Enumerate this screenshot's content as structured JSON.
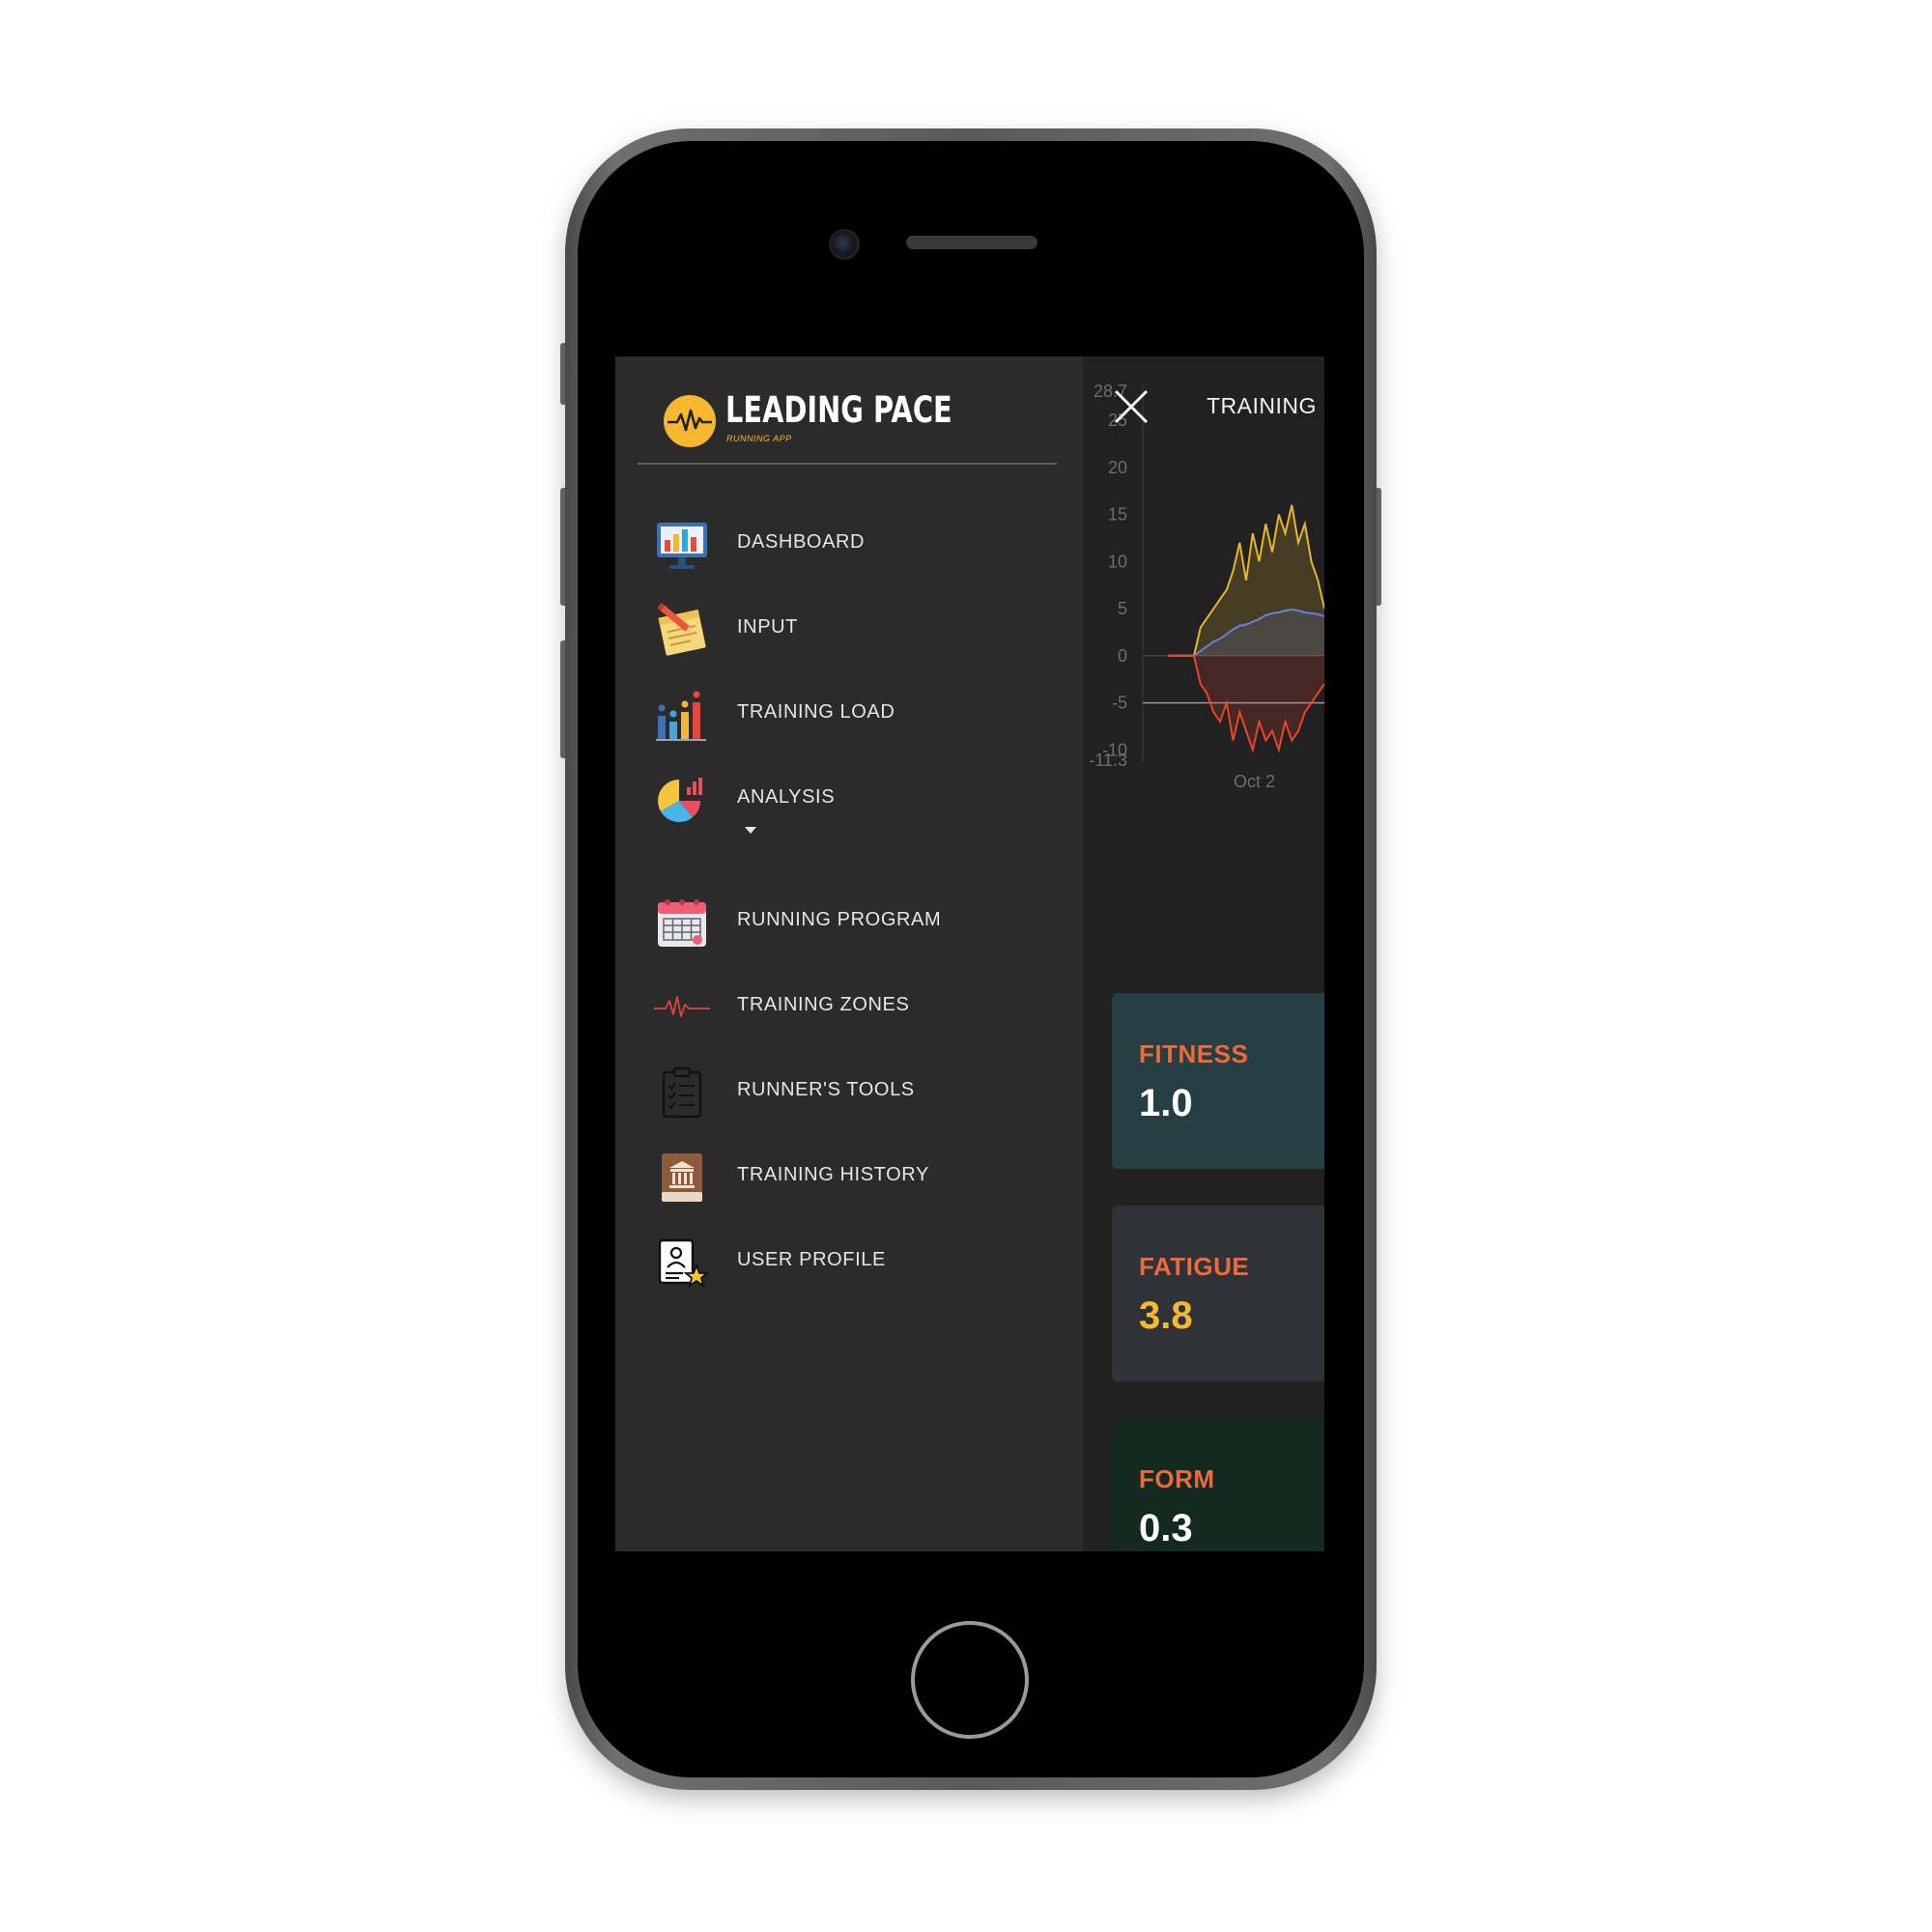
{
  "app": {
    "brand_name": "LEADING PACE",
    "brand_tagline": "RUNNING APP",
    "accent_color": "#f7b731"
  },
  "drawer": {
    "items": [
      {
        "label": "DASHBOARD",
        "icon": "dashboard-monitor-icon"
      },
      {
        "label": "INPUT",
        "icon": "notepad-pencil-icon"
      },
      {
        "label": "TRAINING LOAD",
        "icon": "bar-chart-icon"
      },
      {
        "label": "ANALYSIS",
        "icon": "pie-chart-icon",
        "expandable": true
      },
      {
        "label": "RUNNING PROGRAM",
        "icon": "calendar-icon"
      },
      {
        "label": "TRAINING ZONES",
        "icon": "heartbeat-icon"
      },
      {
        "label": "RUNNER'S TOOLS",
        "icon": "clipboard-checklist-icon"
      },
      {
        "label": "TRAINING HISTORY",
        "icon": "history-book-icon"
      },
      {
        "label": "USER PROFILE",
        "icon": "profile-badge-star-icon"
      }
    ]
  },
  "topbar": {
    "title": "TRAINING",
    "close_icon": "close-icon"
  },
  "metrics": {
    "fitness": {
      "label": "FITNESS",
      "value": "1.0",
      "bg": "#263f42",
      "value_color": "#ffffff"
    },
    "fatigue": {
      "label": "FATIGUE",
      "value": "3.8",
      "bg": "#2f3338",
      "value_color": "#f7b731"
    },
    "form": {
      "label": "FORM",
      "value": "0.3",
      "bg": "#142a20",
      "value_color": "#ffffff"
    }
  },
  "chart_data": {
    "type": "area",
    "y_max_label": "28.7",
    "y_min_label": "-11.3",
    "y_ticks": [
      "25",
      "20",
      "15",
      "10",
      "5",
      "0",
      "-5",
      "-10"
    ],
    "x_tick_labels": [
      "Oct 2"
    ],
    "ylim": [
      -11.3,
      28.7
    ],
    "series": [
      {
        "color": "#e8b530",
        "values": [
          0,
          0,
          0,
          0,
          0,
          3,
          4,
          5,
          6,
          7,
          9,
          12,
          8,
          13,
          10,
          14,
          11,
          15,
          13,
          16,
          12,
          14,
          10,
          8,
          5
        ]
      },
      {
        "color": "#6c7fd8",
        "values": [
          0,
          0,
          0,
          0,
          0,
          0.5,
          1,
          1.5,
          1.8,
          2.3,
          2.8,
          3.2,
          3.3,
          3.6,
          3.9,
          4.3,
          4.5,
          4.6,
          4.8,
          4.9,
          4.8,
          4.6,
          4.5,
          4.4,
          4.2
        ]
      },
      {
        "color": "#e8452c",
        "values": [
          0,
          0,
          0,
          0,
          0,
          -3,
          -4,
          -6,
          -7,
          -5,
          -9,
          -6,
          -8,
          -10,
          -7,
          -9,
          -8,
          -10,
          -7,
          -9,
          -8,
          -6,
          -5,
          -4,
          -3
        ]
      }
    ]
  }
}
